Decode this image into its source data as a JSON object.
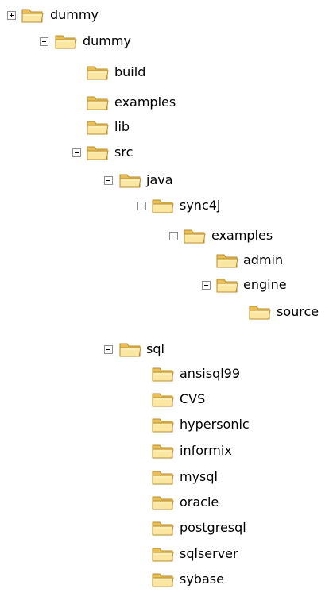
{
  "tree": [
    {
      "label": "dummy",
      "toggle": "plus"
    },
    {
      "label": "dummy",
      "toggle": "minus"
    },
    {
      "label": "build",
      "toggle": "none"
    },
    {
      "label": "examples",
      "toggle": "none"
    },
    {
      "label": "lib",
      "toggle": "none"
    },
    {
      "label": "src",
      "toggle": "minus"
    },
    {
      "label": "java",
      "toggle": "minus"
    },
    {
      "label": "sync4j",
      "toggle": "minus"
    },
    {
      "label": "examples",
      "toggle": "minus"
    },
    {
      "label": "admin",
      "toggle": "none"
    },
    {
      "label": "engine",
      "toggle": "minus"
    },
    {
      "label": "source",
      "toggle": "none"
    },
    {
      "label": "sql",
      "toggle": "minus"
    },
    {
      "label": "ansisql99",
      "toggle": "none"
    },
    {
      "label": "CVS",
      "toggle": "none"
    },
    {
      "label": "hypersonic",
      "toggle": "none"
    },
    {
      "label": "informix",
      "toggle": "none"
    },
    {
      "label": "mysql",
      "toggle": "none"
    },
    {
      "label": "oracle",
      "toggle": "none"
    },
    {
      "label": "postgresql",
      "toggle": "none"
    },
    {
      "label": "sqlserver",
      "toggle": "none"
    },
    {
      "label": "sybase",
      "toggle": "none"
    }
  ]
}
